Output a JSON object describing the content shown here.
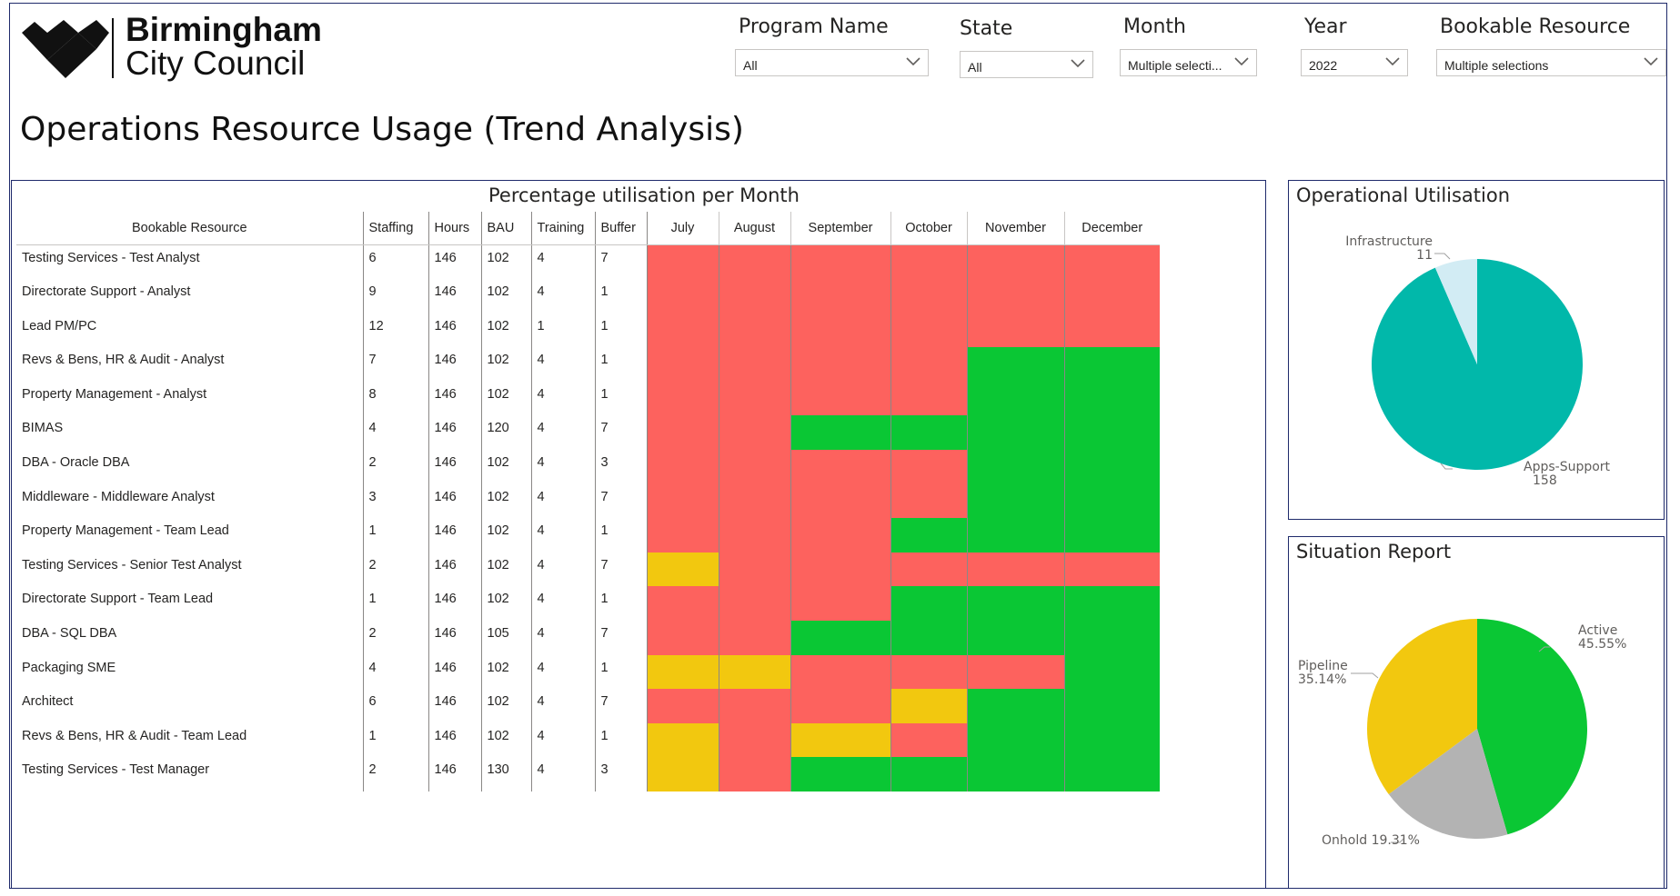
{
  "brand": {
    "line1": "Birmingham",
    "line2": "City Council"
  },
  "title": "Operations Resource Usage (Trend Analysis)",
  "filters": [
    {
      "label": "Program Name",
      "value": "All"
    },
    {
      "label": "State",
      "value": "All"
    },
    {
      "label": "Month",
      "value": "Multiple selecti..."
    },
    {
      "label": "Year",
      "value": "2022"
    },
    {
      "label": "Bookable Resource",
      "value": "Multiple selections"
    }
  ],
  "matrix": {
    "title": "Percentage utilisation per Month",
    "columns": [
      "Bookable Resource",
      "Staffing",
      "Hours",
      "BAU",
      "Training",
      "Buffer"
    ],
    "months": [
      "July",
      "August",
      "September",
      "October",
      "November",
      "December"
    ],
    "colors": {
      "R": "#fd625e",
      "G": "#0ac734",
      "Y": "#f2c80f"
    },
    "rows": [
      {
        "resource": "Testing Services - Test Analyst",
        "staffing": "6",
        "hours": "146",
        "bau": "102",
        "training": "4",
        "buffer": "7",
        "status": [
          "R",
          "R",
          "R",
          "R",
          "R",
          "R"
        ]
      },
      {
        "resource": "Directorate Support - Analyst",
        "staffing": "9",
        "hours": "146",
        "bau": "102",
        "training": "4",
        "buffer": "1",
        "status": [
          "R",
          "R",
          "R",
          "R",
          "R",
          "R"
        ]
      },
      {
        "resource": "Lead PM/PC",
        "staffing": "12",
        "hours": "146",
        "bau": "102",
        "training": "1",
        "buffer": "1",
        "status": [
          "R",
          "R",
          "R",
          "R",
          "R",
          "R"
        ]
      },
      {
        "resource": "Revs & Bens, HR & Audit - Analyst",
        "staffing": "7",
        "hours": "146",
        "bau": "102",
        "training": "4",
        "buffer": "1",
        "status": [
          "R",
          "R",
          "R",
          "R",
          "G",
          "G"
        ]
      },
      {
        "resource": "Property Management - Analyst",
        "staffing": "8",
        "hours": "146",
        "bau": "102",
        "training": "4",
        "buffer": "1",
        "status": [
          "R",
          "R",
          "R",
          "R",
          "G",
          "G"
        ]
      },
      {
        "resource": "BIMAS",
        "staffing": "4",
        "hours": "146",
        "bau": "120",
        "training": "4",
        "buffer": "7",
        "status": [
          "R",
          "R",
          "G",
          "G",
          "G",
          "G"
        ]
      },
      {
        "resource": "DBA - Oracle DBA",
        "staffing": "2",
        "hours": "146",
        "bau": "102",
        "training": "4",
        "buffer": "3",
        "status": [
          "R",
          "R",
          "R",
          "R",
          "G",
          "G"
        ]
      },
      {
        "resource": "Middleware - Middleware Analyst",
        "staffing": "3",
        "hours": "146",
        "bau": "102",
        "training": "4",
        "buffer": "7",
        "status": [
          "R",
          "R",
          "R",
          "R",
          "G",
          "G"
        ]
      },
      {
        "resource": "Property Management - Team Lead",
        "staffing": "1",
        "hours": "146",
        "bau": "102",
        "training": "4",
        "buffer": "1",
        "status": [
          "R",
          "R",
          "R",
          "G",
          "G",
          "G"
        ]
      },
      {
        "resource": "Testing Services - Senior Test Analyst",
        "staffing": "2",
        "hours": "146",
        "bau": "102",
        "training": "4",
        "buffer": "7",
        "status": [
          "Y",
          "R",
          "R",
          "R",
          "R",
          "R"
        ]
      },
      {
        "resource": "Directorate Support - Team Lead",
        "staffing": "1",
        "hours": "146",
        "bau": "102",
        "training": "4",
        "buffer": "1",
        "status": [
          "R",
          "R",
          "R",
          "G",
          "G",
          "G"
        ]
      },
      {
        "resource": "DBA - SQL DBA",
        "staffing": "2",
        "hours": "146",
        "bau": "105",
        "training": "4",
        "buffer": "7",
        "status": [
          "R",
          "R",
          "G",
          "G",
          "G",
          "G"
        ]
      },
      {
        "resource": "Packaging SME",
        "staffing": "4",
        "hours": "146",
        "bau": "102",
        "training": "4",
        "buffer": "1",
        "status": [
          "Y",
          "Y",
          "R",
          "R",
          "R",
          "G"
        ]
      },
      {
        "resource": "Architect",
        "staffing": "6",
        "hours": "146",
        "bau": "102",
        "training": "4",
        "buffer": "7",
        "status": [
          "R",
          "R",
          "R",
          "Y",
          "G",
          "G"
        ]
      },
      {
        "resource": "Revs & Bens, HR & Audit - Team Lead",
        "staffing": "1",
        "hours": "146",
        "bau": "102",
        "training": "4",
        "buffer": "1",
        "status": [
          "Y",
          "R",
          "Y",
          "R",
          "G",
          "G"
        ]
      },
      {
        "resource": "Testing Services - Test Manager",
        "staffing": "2",
        "hours": "146",
        "bau": "130",
        "training": "4",
        "buffer": "3",
        "status": [
          "Y",
          "R",
          "G",
          "G",
          "G",
          "G"
        ]
      }
    ]
  },
  "chart_data": [
    {
      "type": "pie",
      "title": "Operational Utilisation",
      "slices": [
        {
          "label": "Apps-Support",
          "value": 158,
          "display": "158",
          "color": "#01b8aa"
        },
        {
          "label": "Infrastructure",
          "value": 11,
          "display": "11",
          "color": "#d2ecf4"
        }
      ]
    },
    {
      "type": "pie",
      "title": "Situation Report",
      "slices": [
        {
          "label": "Active",
          "value": 45.55,
          "display": "45.55%",
          "color": "#0ac734"
        },
        {
          "label": "Onhold",
          "value": 19.31,
          "display": "19.31%",
          "color": "#b3b3b3"
        },
        {
          "label": "Pipeline",
          "value": 35.14,
          "display": "35.14%",
          "color": "#f2c80f"
        }
      ]
    }
  ]
}
